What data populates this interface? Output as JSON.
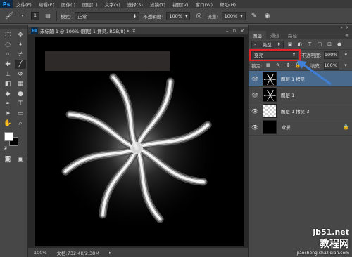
{
  "menubar": {
    "logo": "Ps",
    "items": [
      "文件(F)",
      "编辑(E)",
      "图像(I)",
      "图层(L)",
      "文字(Y)",
      "选择(S)",
      "滤镜(T)",
      "视图(V)",
      "窗口(W)",
      "帮助(H)"
    ]
  },
  "options": {
    "brush_size": "1",
    "mode_label": "模式:",
    "mode_value": "正常",
    "opacity_label": "不透明度:",
    "opacity_value": "100%",
    "flow_label": "流量:",
    "flow_value": "100%"
  },
  "document": {
    "title": "未标题-1 @ 100% (图层 1 拷贝, RGB/8) *",
    "zoom": "100%",
    "doc_size": "文档:732.4K/2.38M"
  },
  "panels": {
    "tabs": [
      "图层",
      "通道",
      "路径"
    ],
    "kind_label": "类型",
    "blend_mode": "变亮",
    "opacity_label": "不透明度:",
    "opacity_value": "100%",
    "lock_label": "锁定:",
    "fill_label": "填充:",
    "fill_value": "100%",
    "layers": [
      {
        "name": "图层 1 拷贝"
      },
      {
        "name": "图层 1"
      },
      {
        "name": "图层 1 拷贝 3"
      },
      {
        "name": "背景"
      }
    ]
  },
  "watermark": {
    "site": "jb51.net",
    "name": "教程网",
    "url": "jiaocheng.chazidian.com"
  },
  "colors": {
    "highlight": "#e2232a",
    "selected_layer": "#4a6a8d",
    "arrow": "#3f7fd6"
  }
}
